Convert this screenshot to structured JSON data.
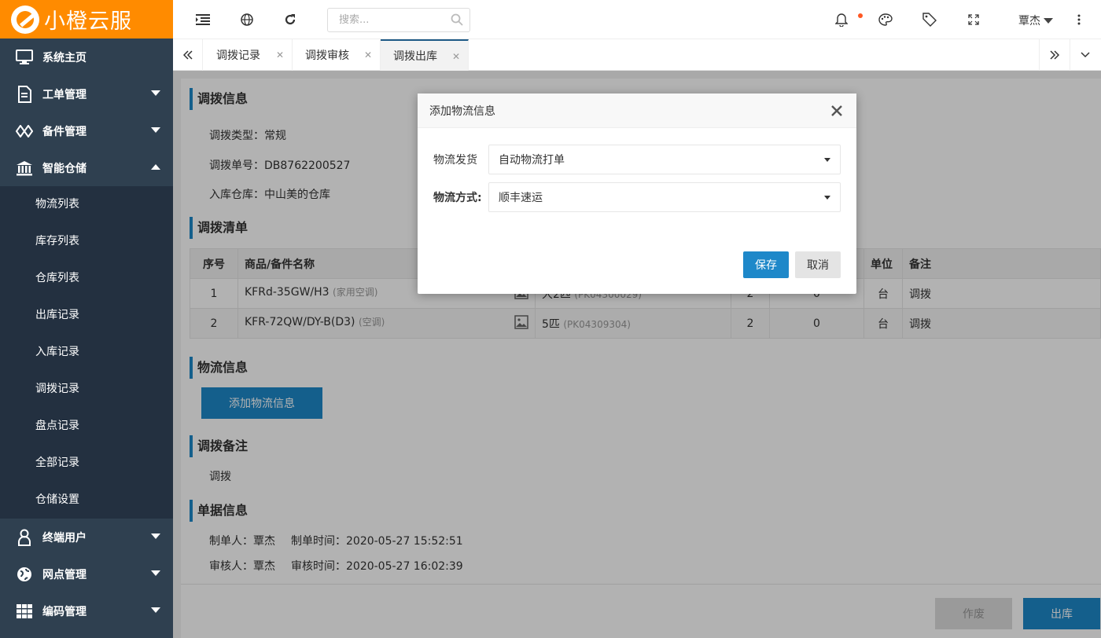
{
  "app": {
    "brand": "小橙云服"
  },
  "sidebar": {
    "items": [
      {
        "label": "系统主页",
        "icon": "monitor-icon"
      },
      {
        "label": "工单管理",
        "icon": "document-icon"
      },
      {
        "label": "备件管理",
        "icon": "diamond-link-icon"
      },
      {
        "label": "智能仓储",
        "icon": "bank-icon"
      },
      {
        "label": "终端用户",
        "icon": "user-icon"
      },
      {
        "label": "网点管理",
        "icon": "globe-icon"
      },
      {
        "label": "编码管理",
        "icon": "grid-icon"
      }
    ],
    "submenu": [
      "物流列表",
      "库存列表",
      "仓库列表",
      "出库记录",
      "入库记录",
      "调拨记录",
      "盘点记录",
      "全部记录",
      "仓储设置"
    ]
  },
  "topbar": {
    "search_placeholder": "搜索...",
    "user_name": "覃杰"
  },
  "tabs": [
    "调拨记录",
    "调拨审核",
    "调拨出库"
  ],
  "content": {
    "sections": {
      "transfer_info": "调拨信息",
      "transfer_list": "调拨清单",
      "logistics_info": "物流信息",
      "transfer_remark": "调拨备注",
      "doc_info": "单据信息"
    },
    "transfer_type": "调拨类型：常规",
    "transfer_no": "调拨单号：DB8762200527",
    "inbound_warehouse": "入库仓库：中山美的仓库",
    "table": {
      "headers": [
        "序号",
        "商品/备件名称",
        "",
        "",
        "",
        "单位",
        "备注"
      ],
      "rows": [
        {
          "no": "1",
          "name": "KFRd-35GW/H3",
          "name_note": "(家用空调)",
          "spec": "大2匹",
          "spec_code": "(PK04300029)",
          "qty": "2",
          "qty2": "0",
          "unit": "台",
          "remark": "调拨"
        },
        {
          "no": "2",
          "name": "KFR-72QW/DY-B(D3)",
          "name_note": "(空调)",
          "spec": "5匹",
          "spec_code": "(PK04309304)",
          "qty": "2",
          "qty2": "0",
          "unit": "台",
          "remark": "调拨"
        }
      ]
    },
    "add_logistics_button": "添加物流信息",
    "remark_text": "调拨",
    "creator_line": "制单人：覃杰",
    "create_time": "制单时间：2020-05-27 15:52:51",
    "reviewer_line": "审核人：覃杰",
    "review_time": "审核时间：2020-05-27 16:02:39",
    "void_button": "作废",
    "outbound_button": "出库"
  },
  "modal": {
    "title": "添加物流信息",
    "field1_label": "物流发货",
    "field1_value": "自动物流打单",
    "field2_label": "物流方式:",
    "field2_value": "顺丰速运",
    "save": "保存",
    "cancel": "取消"
  }
}
